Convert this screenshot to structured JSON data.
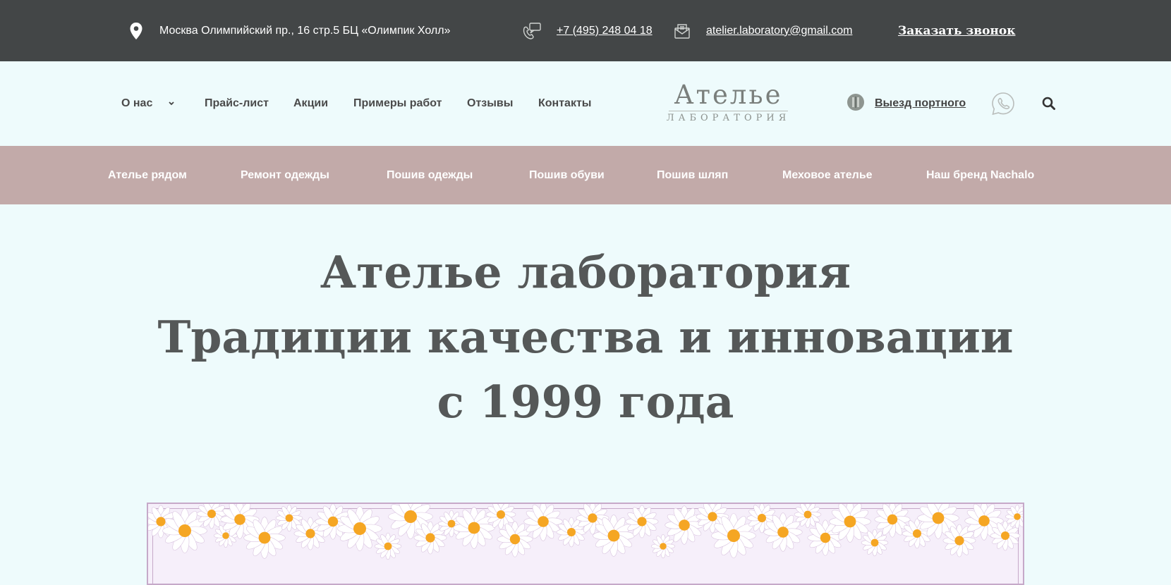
{
  "topbar": {
    "address": "Москва Олимпийский пр., 16 стр.5 БЦ «Олимпик Холл»",
    "phone": "+7 (495) 248 04 18",
    "email": "atelier.laboratory@gmail.com",
    "callback": "Заказать звонок",
    "icons": [
      "location-pin-icon",
      "phone-icon",
      "mail-icon"
    ]
  },
  "nav": {
    "items": [
      "О нас",
      "Прайс-лист",
      "Акции",
      "Примеры работ",
      "Отзывы",
      "Контакты"
    ]
  },
  "logo": {
    "title": "Ателье",
    "subtitle": "ЛАБОРАТОРИЯ"
  },
  "header_actions": {
    "visit_label": "Выезд портного",
    "icons": [
      "tailor-icon",
      "whatsapp-icon",
      "search-icon"
    ]
  },
  "categories": [
    "Ателье рядом",
    "Ремонт одежды",
    "Пошив одежды",
    "Пошив обуви",
    "Пошив шляп",
    "Меховое ателье",
    "Наш бренд Nachalo"
  ],
  "hero": {
    "line1": "Ателье лаборатория",
    "line2": "Традиции качества и инновации",
    "line3": "с 1999 года"
  },
  "colors": {
    "topbar": "#434647",
    "page_bg": "#eefbfc",
    "category_bar": "#c2aaa9",
    "hero_text": "#555858",
    "flower_center": "#f5a623",
    "banner_border": "#c6a9c9"
  }
}
